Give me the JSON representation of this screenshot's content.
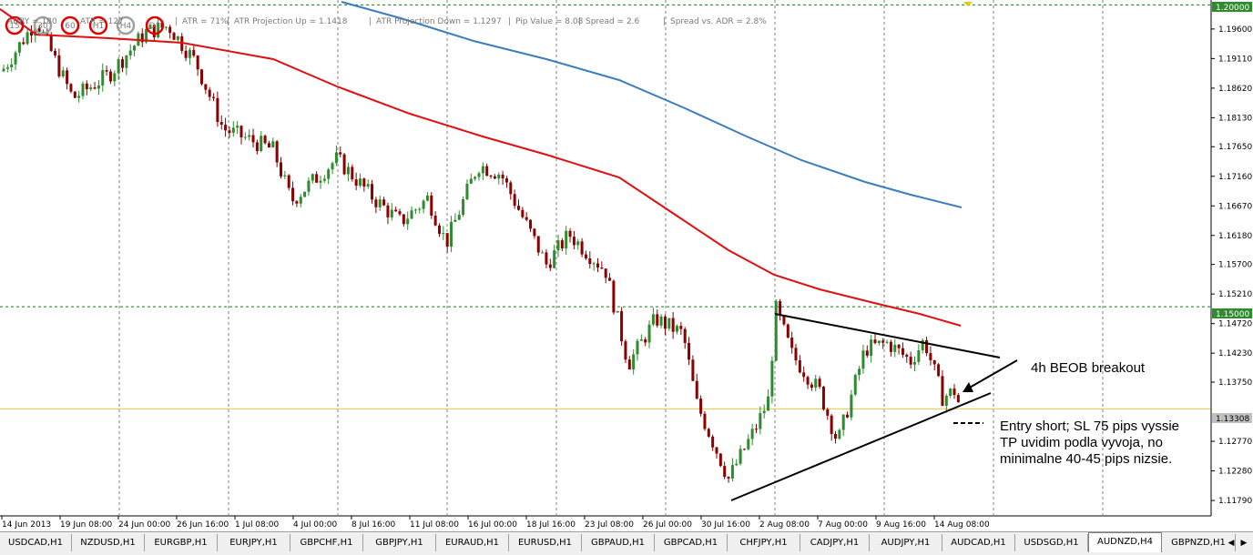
{
  "info_bar": {
    "items": [
      "ADRY = 180",
      "ATR = 127",
      "ATR = 71%",
      "ATR Projection Up = 1.1418",
      "ATR Projection Down = 1.1297",
      "Pip Value = 8.08",
      "Spread = 2.6",
      "Spread vs. ADR = 2.8%"
    ],
    "timeframes": [
      "15",
      "30",
      "60",
      "H1",
      "H4",
      "D1"
    ]
  },
  "annotations": {
    "breakout_label": "4h BEOB breakout",
    "entry_line1": "Entry short; SL 75 pips vyssie",
    "entry_line2": "TP uvidim podla vyvoja, no",
    "entry_line3": "minimalne 40-45 pips nizsie."
  },
  "price_axis": {
    "ticks": [
      "1.19600",
      "1.19110",
      "1.18620",
      "1.18130",
      "1.17650",
      "1.17160",
      "1.16670",
      "1.16180",
      "1.15700",
      "1.15210",
      "1.14720",
      "1.14230",
      "1.13750",
      "1.12770",
      "1.12280",
      "1.11790"
    ],
    "highlight_top": "1.20000",
    "highlight_mid": "1.15000",
    "current_price": "1.13308"
  },
  "time_axis": {
    "labels": [
      "14 Jun 2013",
      "19 Jun 08:00",
      "24 Jun 00:00",
      "26 Jun 16:00",
      "1 Jul 08:00",
      "4 Jul 00:00",
      "8 Jul 16:00",
      "11 Jul 08:00",
      "16 Jul 00:00",
      "18 Jul 16:00",
      "23 Jul 08:00",
      "26 Jul 00:00",
      "30 Jul 16:00",
      "2 Aug 08:00",
      "7 Aug 00:00",
      "9 Aug 16:00",
      "14 Aug 08:00"
    ]
  },
  "tabs": [
    "USDCAD,H1",
    "NZDUSD,H1",
    "EURGBP,H1",
    "EURJPY,H1",
    "GBPCHF,H1",
    "GBPJPY,H1",
    "EURAUD,H1",
    "EURUSD,H1",
    "GBPAUD,H1",
    "GBPCAD,H1",
    "CHFJPY,H1",
    "CADJPY,H1",
    "AUDJPY,H1",
    "AUDCAD,H1",
    "USDSGD,H1",
    "AUDNZD,H4",
    "GBPNZD,H1"
  ],
  "active_tab": "AUDNZD,H4",
  "colors": {
    "bull": "#2e8b2e",
    "bear": "#8b0000",
    "ma_fast": "#e01010",
    "ma_slow": "#3a7ec0",
    "grid": "#808080",
    "current_line": "#e8c84a"
  },
  "chart_data": {
    "type": "candlestick",
    "symbol_timeframe": "AUDNZD,H4",
    "price_range": [
      1.1155,
      1.2005
    ],
    "horizontal_levels": [
      1.2,
      1.15,
      1.13308
    ],
    "key_prices": {
      "range_high": 1.1505,
      "range_low": 1.1205,
      "last_close": 1.13308
    }
  }
}
